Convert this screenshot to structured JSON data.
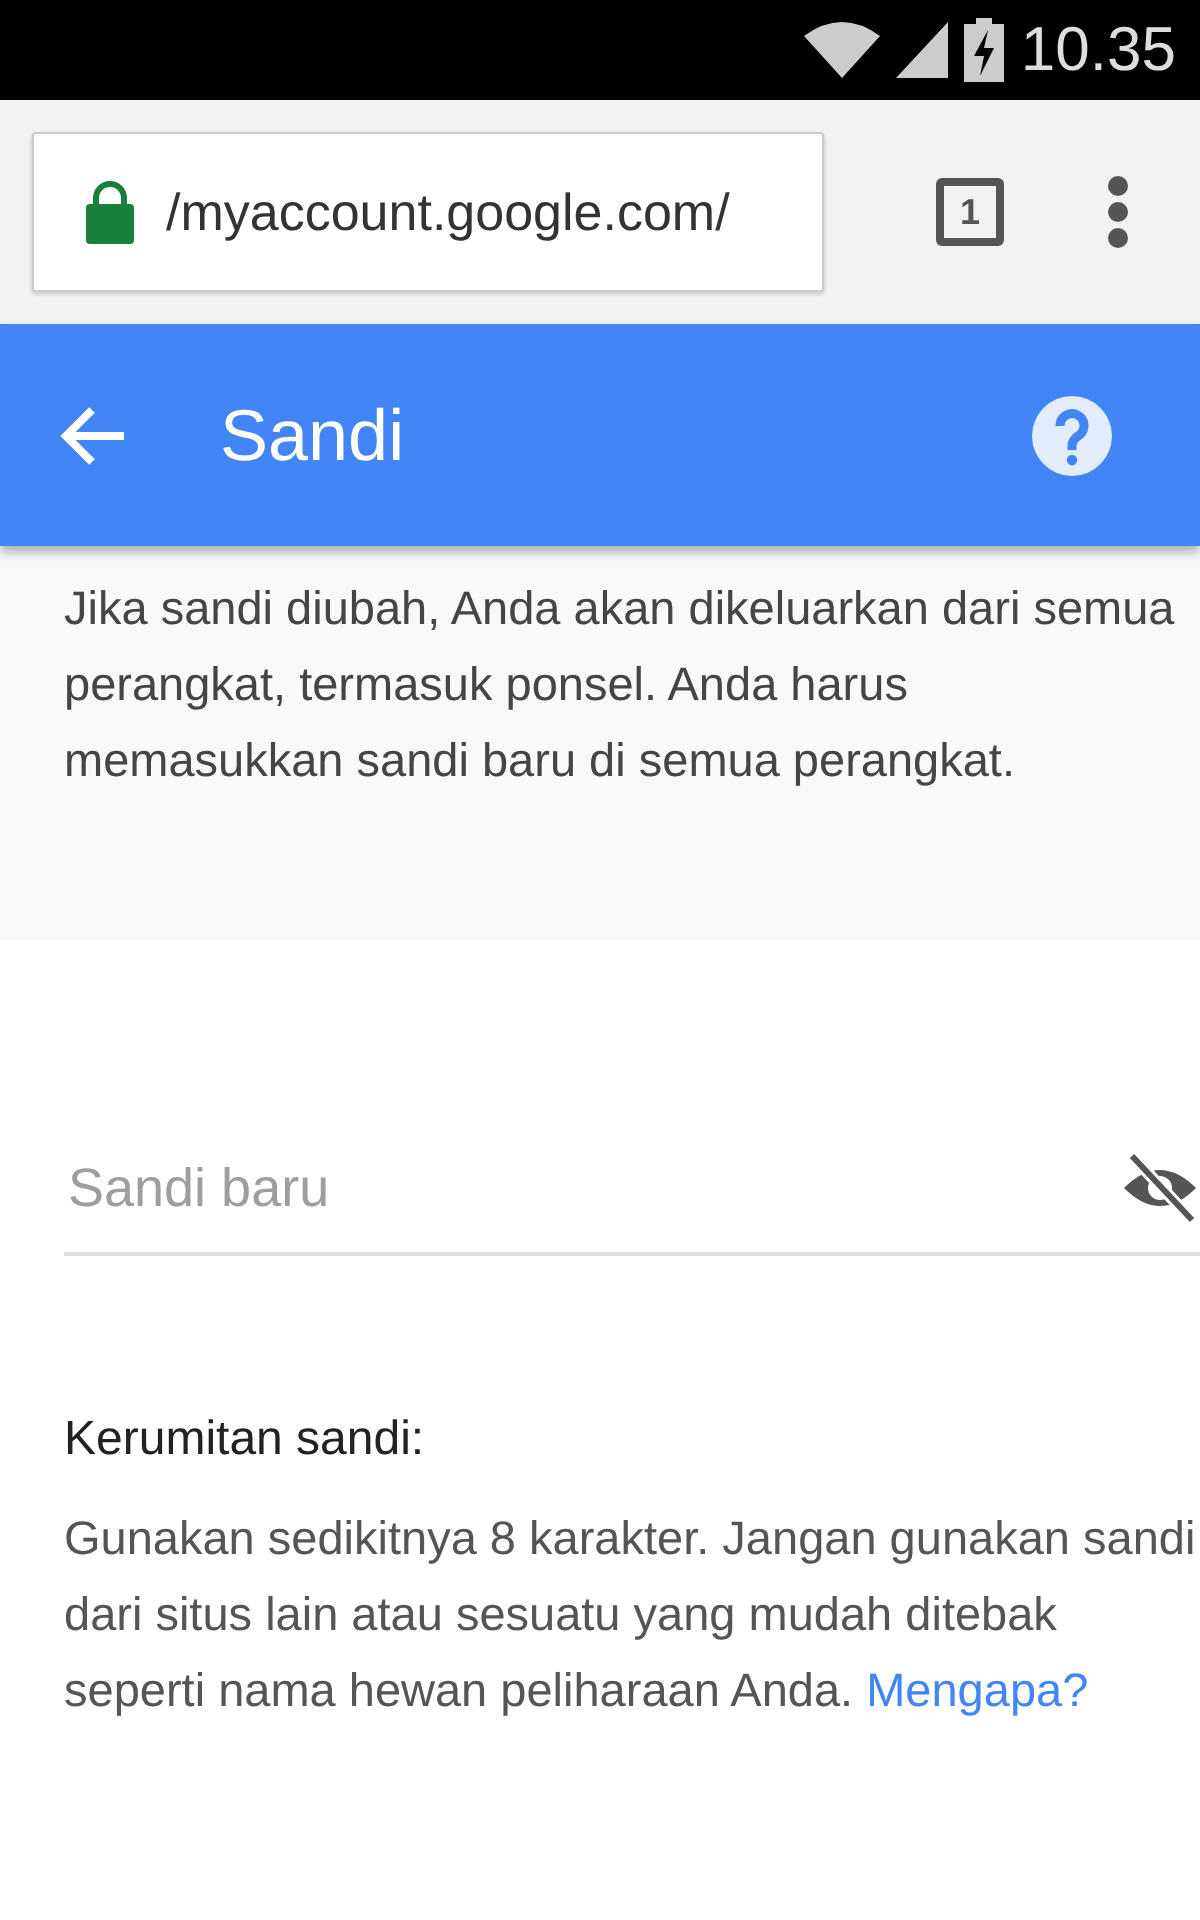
{
  "status_bar": {
    "time": "10.35"
  },
  "browser": {
    "url": "/myaccount.google.com/",
    "secure": true,
    "tab_count": "1"
  },
  "app_bar": {
    "title": "Sandi"
  },
  "notice": "Jika sandi diubah, Anda akan dikeluarkan dari semua perangkat, termasuk ponsel. Anda harus memasukkan sandi baru di semua perangkat.",
  "password_field": {
    "placeholder": "Sandi baru",
    "visible": false
  },
  "strength": {
    "heading": "Kerumitan sandi:",
    "text": "Gunakan sedikitnya 8 karakter. Jangan gunakan sandi dari situs lain atau sesuatu yang mudah ditebak seperti nama hewan peliharaan Anda.",
    "link": "Mengapa?"
  }
}
